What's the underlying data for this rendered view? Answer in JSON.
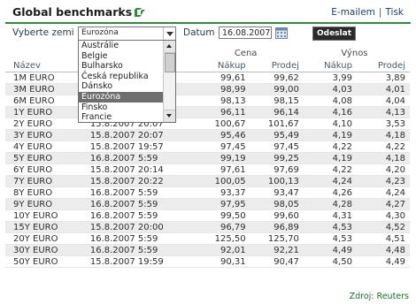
{
  "header": {
    "title": "Global benchmarks",
    "links": {
      "email": "E-mailem",
      "print": "Tisk",
      "separator": "|"
    }
  },
  "controls": {
    "zone_label": "Vyberte zemi",
    "zone_value": "Eurozóna",
    "date_label": "Datum",
    "date_value": "16.08.2007",
    "submit_label": "Odeslat"
  },
  "dropdown": {
    "options": [
      "Austrálie",
      "Belgie",
      "Bulharsko",
      "Česká republika",
      "Dánsko",
      "Eurozóna",
      "Finsko",
      "Francie"
    ],
    "selected_index": 5
  },
  "table": {
    "group_headers": {
      "price": "Cena",
      "yield": "Výnos"
    },
    "columns": {
      "name": "Název",
      "bid": "Nákup",
      "ask": "Prodej",
      "ybid": "Nákup",
      "yask": "Prodej"
    },
    "rows": [
      {
        "name": "1M EURO",
        "time": "",
        "bid": "99,61",
        "ask": "99,62",
        "ybid": "3,99",
        "yask": "3,89"
      },
      {
        "name": "3M EURO",
        "time": "",
        "bid": "98,99",
        "ask": "99,00",
        "ybid": "4,03",
        "yask": "4,01"
      },
      {
        "name": "6M EURO",
        "time": "",
        "bid": "98,13",
        "ask": "98,15",
        "ybid": "4,08",
        "yask": "4,04"
      },
      {
        "name": "1Y EURO",
        "time": "",
        "bid": "96,11",
        "ask": "96,14",
        "ybid": "4,16",
        "yask": "4,13"
      },
      {
        "name": "2Y EURO",
        "time": "15.8.2007 20:07",
        "bid": "100,67",
        "ask": "101,67",
        "ybid": "4,10",
        "yask": "3,53"
      },
      {
        "name": "3Y EURO",
        "time": "15.8.2007 20:07",
        "bid": "95,46",
        "ask": "95,49",
        "ybid": "4,19",
        "yask": "4,18"
      },
      {
        "name": "4Y EURO",
        "time": "15.8.2007 19:57",
        "bid": "97,45",
        "ask": "97,45",
        "ybid": "4,22",
        "yask": "4,22"
      },
      {
        "name": "5Y EURO",
        "time": "16.8.2007 5:59",
        "bid": "99,19",
        "ask": "99,25",
        "ybid": "4,19",
        "yask": "4,18"
      },
      {
        "name": "6Y EURO",
        "time": "15.8.2007 20:14",
        "bid": "97,61",
        "ask": "97,69",
        "ybid": "4,22",
        "yask": "4,20"
      },
      {
        "name": "7Y EURO",
        "time": "15.8.2007 20:22",
        "bid": "100,05",
        "ask": "100,13",
        "ybid": "4,24",
        "yask": "4,23"
      },
      {
        "name": "8Y EURO",
        "time": "16.8.2007 5:59",
        "bid": "93,37",
        "ask": "93,47",
        "ybid": "4,26",
        "yask": "4,24"
      },
      {
        "name": "9Y EURO",
        "time": "16.8.2007 5:59",
        "bid": "97,95",
        "ask": "98,05",
        "ybid": "4,28",
        "yask": "4,27"
      },
      {
        "name": "10Y EURO",
        "time": "16.8.2007 5:59",
        "bid": "99,50",
        "ask": "99,60",
        "ybid": "4,31",
        "yask": "4,30"
      },
      {
        "name": "15Y EURO",
        "time": "15.8.2007 20:00",
        "bid": "96,79",
        "ask": "96,89",
        "ybid": "4,53",
        "yask": "4,52"
      },
      {
        "name": "20Y EURO",
        "time": "16.8.2007 5:59",
        "bid": "125,50",
        "ask": "125,70",
        "ybid": "4,53",
        "yask": "4,51"
      },
      {
        "name": "30Y EURO",
        "time": "16.8.2007 5:59",
        "bid": "92,01",
        "ask": "92,21",
        "ybid": "4,49",
        "yask": "4,48"
      },
      {
        "name": "50Y EURO",
        "time": "15.8.2007 19:59",
        "bid": "90,31",
        "ask": "90,47",
        "ybid": "4,50",
        "yask": "4,49"
      }
    ]
  },
  "source": "Zdroj: Reuters",
  "colors": {
    "accent_green": "#2e8b3a",
    "button_dark": "#2a2a2a",
    "row_stripe": "#ececec"
  }
}
